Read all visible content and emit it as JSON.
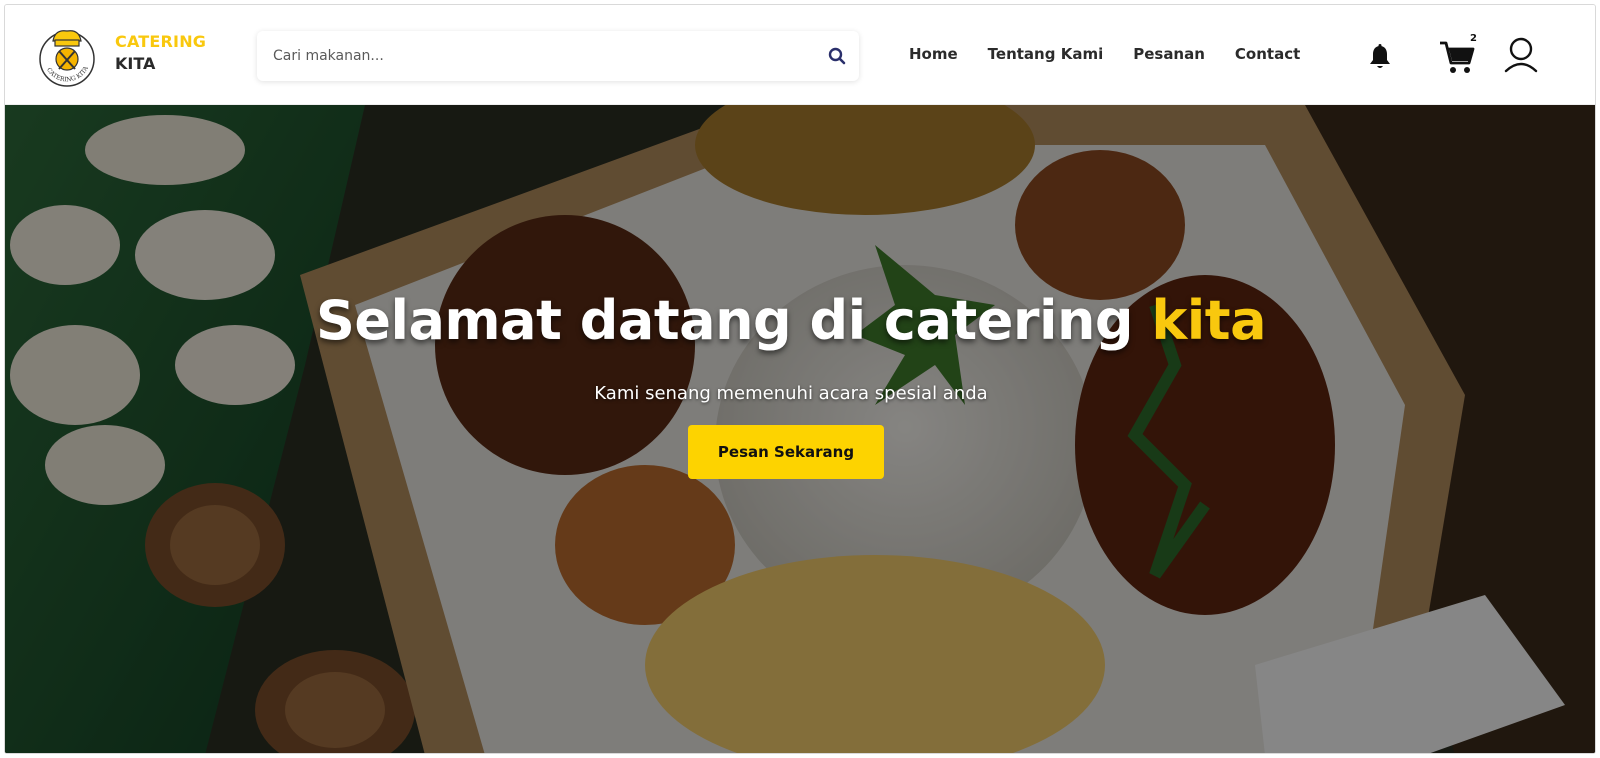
{
  "brand": {
    "line1": "CATERING",
    "line2": "KITA",
    "logo_text": "CATERING KITA"
  },
  "search": {
    "placeholder": "Cari makanan...",
    "icon": "search-icon"
  },
  "nav": {
    "items": [
      {
        "label": "Home"
      },
      {
        "label": "Tentang Kami"
      },
      {
        "label": "Pesanan"
      },
      {
        "label": "Contact"
      }
    ]
  },
  "actions": {
    "notification_icon": "bell-icon",
    "cart_icon": "cart-icon",
    "cart_count": "2",
    "user_icon": "user-icon"
  },
  "hero": {
    "title_main": "Selamat datang di catering ",
    "title_accent": "kita",
    "subtitle": "Kami senang memenuhi acara spesial anda",
    "cta_label": "Pesan Sekarang"
  },
  "colors": {
    "accent": "#f9c80e",
    "button": "#fdd300",
    "text_dark": "#2b2b2b"
  }
}
